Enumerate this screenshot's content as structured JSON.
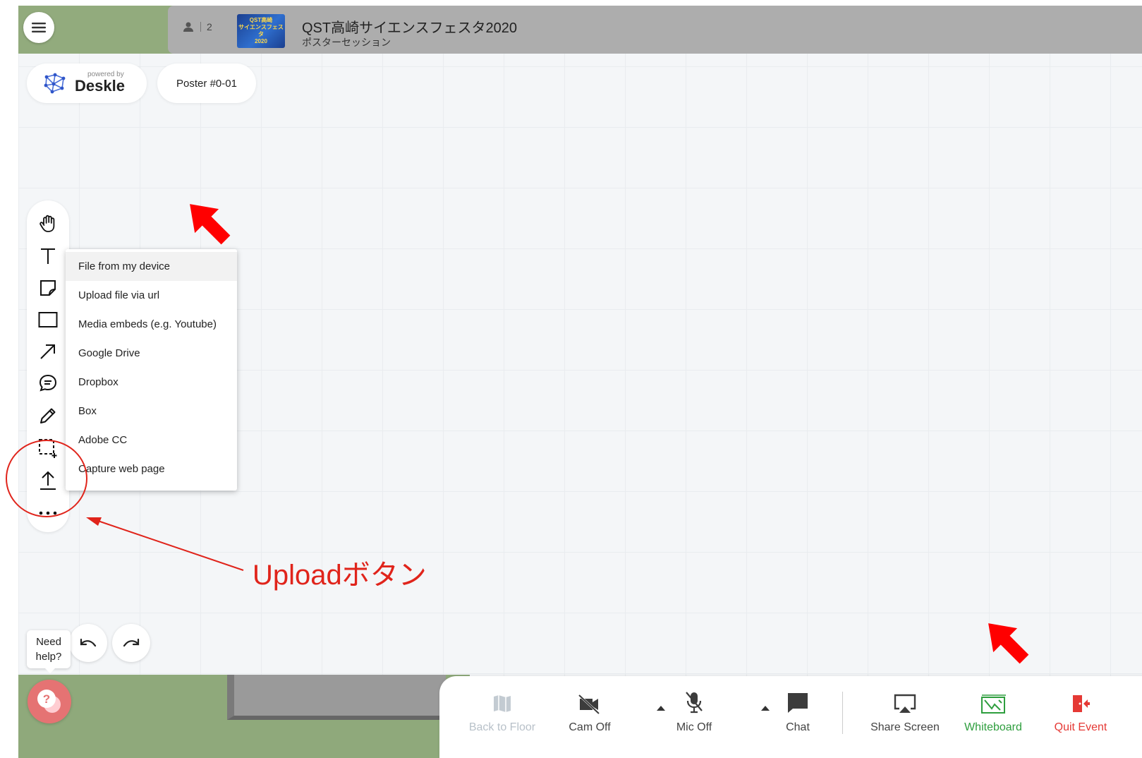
{
  "header": {
    "participant_count": "2",
    "event_thumb_text": "QST高崎\nサイエンスフェスタ\n2020",
    "event_title": "QST高崎サイエンスフェスタ2020",
    "event_subtitle": "ポスターセッション"
  },
  "branding": {
    "powered_by": "powered by",
    "name": "Deskle"
  },
  "board": {
    "poster_label": "Poster #0-01"
  },
  "tools": [
    "hand-icon",
    "text-icon",
    "sticky-note-icon",
    "rectangle-icon",
    "arrow-icon",
    "comment-icon",
    "pencil-icon",
    "select-area-icon",
    "upload-icon",
    "more-icon"
  ],
  "upload_menu": {
    "items": [
      "File from my device",
      "Upload file via url",
      "Media embeds (e.g. Youtube)",
      "Google Drive",
      "Dropbox",
      "Box",
      "Adobe CC",
      "Capture web page"
    ]
  },
  "help": {
    "tooltip_line1": "Need",
    "tooltip_line2": "help?"
  },
  "controls": {
    "back_to_floor": "Back to Floor",
    "cam_off": "Cam Off",
    "mic_off": "Mic Off",
    "chat": "Chat",
    "share_screen": "Share Screen",
    "whiteboard": "Whiteboard",
    "quit_event": "Quit Event"
  },
  "colors": {
    "annotation": "#e0241b",
    "whiteboard_active": "#2e9e3e",
    "quit": "#e53935",
    "disabled": "#aab4bd"
  },
  "annotation": {
    "label": "Uploadボタン"
  }
}
